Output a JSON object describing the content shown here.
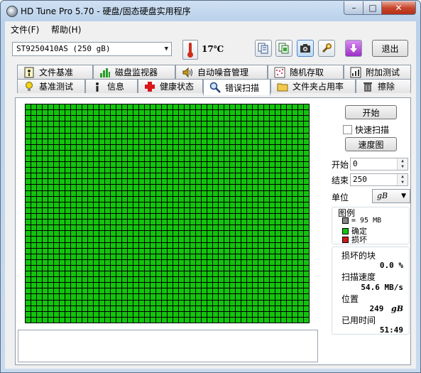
{
  "window": {
    "title": "HD Tune Pro 5.70 - 硬盘/固态硬盘实用程序",
    "minimize": "–",
    "maximize": "□",
    "close": "✕"
  },
  "menu": {
    "file": "文件(F)",
    "help": "帮助(H)"
  },
  "toolbar": {
    "drive": "ST9250410AS  (250 gB)",
    "temperature": "17℃",
    "exit_label": "退出",
    "icons": [
      "copy-icon",
      "copy-info-icon",
      "screenshot-icon",
      "options-icon",
      "save-icon"
    ]
  },
  "tabs": {
    "row1": [
      {
        "label": "文件基准",
        "icon": "file-benchmark-icon"
      },
      {
        "label": "磁盘监视器",
        "icon": "disk-monitor-icon"
      },
      {
        "label": "自动噪音管理",
        "icon": "speaker-icon"
      },
      {
        "label": "随机存取",
        "icon": "random-access-icon"
      },
      {
        "label": "附加测试",
        "icon": "extra-tests-icon"
      }
    ],
    "row2": [
      {
        "label": "基准测试",
        "icon": "bulb-icon"
      },
      {
        "label": "信息",
        "icon": "info-icon"
      },
      {
        "label": "健康状态",
        "icon": "health-cross-icon"
      },
      {
        "label": "错误扫描",
        "icon": "magnifier-icon",
        "active": true
      },
      {
        "label": "文件夹占用率",
        "icon": "folder-icon"
      },
      {
        "label": "擦除",
        "icon": "trash-icon"
      }
    ]
  },
  "scan": {
    "start_button": "开始",
    "quick_scan_label": "快速扫描",
    "quick_scan_checked": false,
    "speed_map_button": "速度图",
    "start_label": "开始",
    "start_value": "0",
    "end_label": "结束",
    "end_value": "250",
    "unit_label": "单位",
    "unit_value": "gB",
    "grid_rows": 38,
    "grid_cols": 50,
    "block_color": "#13c40d",
    "legend": {
      "title": "图例",
      "block_size": "= 95 MB",
      "ok": "确定",
      "damaged": "损坏",
      "block_color": "#888888",
      "ok_color": "#13c40d",
      "damaged_color": "#d01818"
    },
    "stats": {
      "damaged_blocks_label": "损坏的块",
      "damaged_blocks_value": "0.0 %",
      "scan_speed_label": "扫描速度",
      "scan_speed_value": "54.6 MB/s",
      "position_label": "位置",
      "position_value": "249",
      "position_unit": "gB",
      "elapsed_label": "已用时间",
      "elapsed_value": "51:49"
    }
  }
}
